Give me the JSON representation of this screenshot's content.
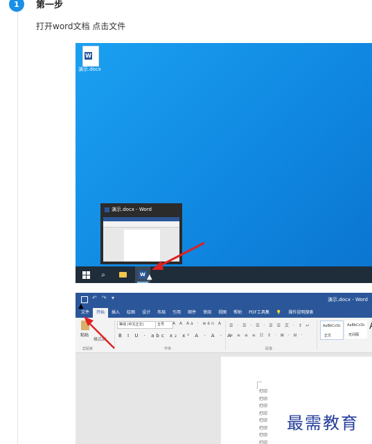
{
  "step": {
    "number": "1",
    "title": "第一步",
    "description": "打开word文档  点击文件"
  },
  "desktop": {
    "file_icon_label": "演示.docx",
    "thumbnail_title": "演示.docx - Word",
    "taskbar_word_glyph": "W",
    "desktop_color": "#1296ea",
    "taskbar_color": "#1f2d3a"
  },
  "word": {
    "window_title": "演示.docx - Word",
    "tabs": [
      "文件",
      "开始",
      "插入",
      "绘图",
      "设计",
      "布局",
      "引用",
      "邮件",
      "审阅",
      "视图",
      "帮助",
      "PDF工具集",
      "操作说明搜索"
    ],
    "tellme_icon": "lightbulb-icon",
    "clipboard": {
      "paste": "粘贴",
      "format_painter": "格式刷",
      "group": "剪贴板"
    },
    "font": {
      "name": "等线 (中文正文)",
      "size": "五号",
      "group": "字体",
      "format_glyphs": "B I U · abc x₂ x² A · A · A",
      "size_glyphs": "A A Aa · wén A"
    },
    "paragraph": {
      "group": "段落",
      "row1": "☰ · ☰ · ☰ · ☰ ☰ 文 · ↕ ↵",
      "row2": "≡ ≡ ≡ ≡ ☷ ↕ · ⊞ · ⊟ ·"
    },
    "styles": [
      {
        "sample": "AaBbCcDc",
        "name": "正文"
      },
      {
        "sample": "AaBbCcDc",
        "name": "无间隔"
      },
      {
        "sample": "A",
        "name": ""
      }
    ],
    "doc_lines": [
      "打印",
      "打印",
      "打印",
      "打印",
      "打印",
      "打印",
      "打印",
      "打印"
    ],
    "accent_color": "#2b579a"
  },
  "watermark": "最需教育",
  "annotation_color": "#e12020"
}
